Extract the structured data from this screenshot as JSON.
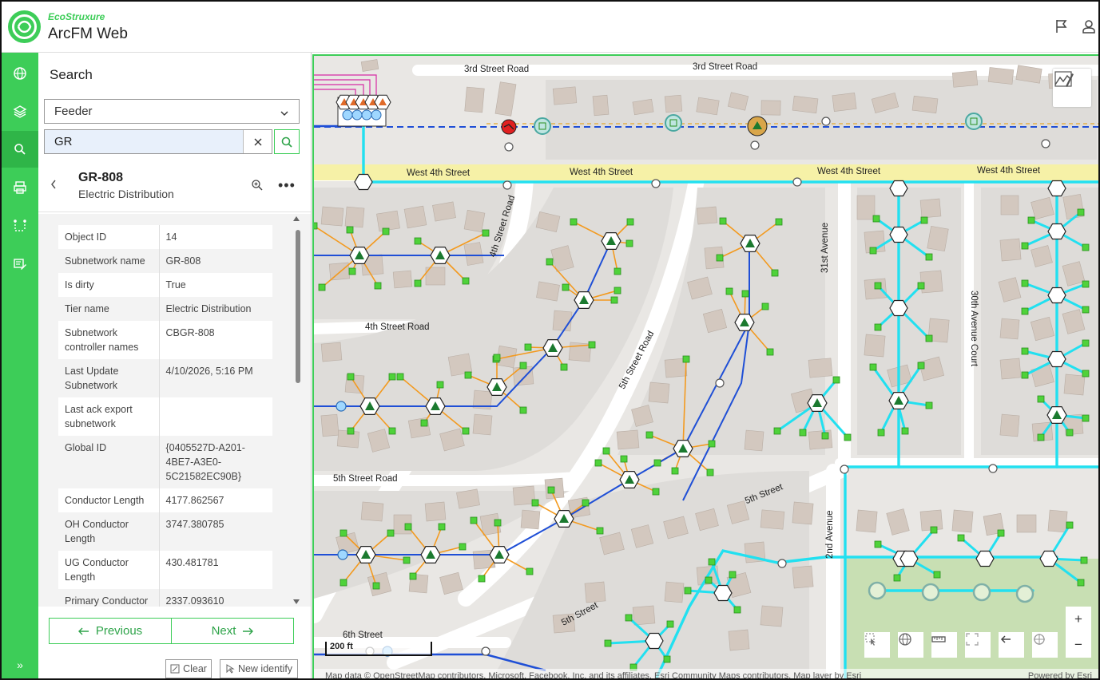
{
  "header": {
    "brand": "EcoStruxure",
    "app_title": "ArcFM Web"
  },
  "rail": {
    "items": [
      {
        "icon": "globe-icon"
      },
      {
        "icon": "layers-icon"
      },
      {
        "icon": "search-icon"
      },
      {
        "icon": "print-icon"
      },
      {
        "icon": "trace-icon"
      },
      {
        "icon": "edit-icon"
      }
    ],
    "collapse_label": "»"
  },
  "panel": {
    "title": "Search",
    "layer_select": "Feeder",
    "search_value": "GR",
    "feature": {
      "title": "GR-808",
      "subtitle": "Electric Distribution"
    },
    "attributes": [
      {
        "key": "Object ID",
        "value": "14"
      },
      {
        "key": "Subnetwork name",
        "value": "GR-808"
      },
      {
        "key": "Is dirty",
        "value": "True"
      },
      {
        "key": "Tier name",
        "value": "Electric Distribution"
      },
      {
        "key": "Subnetwork controller names",
        "value": "CBGR-808"
      },
      {
        "key": "Last Update Subnetwork",
        "value": "4/10/2026, 5:16 PM"
      },
      {
        "key": "Last ack export subnetwork",
        "value": ""
      },
      {
        "key": "Global ID",
        "value": "{0405527D-A201-4BE7-A3E0-5C21582EC90B}"
      },
      {
        "key": "Conductor Length",
        "value": "4177.862567"
      },
      {
        "key": "OH Conductor Length",
        "value": "3747.380785"
      },
      {
        "key": "UG Conductor Length",
        "value": "430.481781"
      },
      {
        "key": "Primary Conductor",
        "value": "2337.093610"
      }
    ],
    "previous_label": "Previous",
    "next_label": "Next",
    "clear_label": "Clear",
    "new_identify_label": "New identify"
  },
  "map": {
    "streets": {
      "third_street_road_a": "3rd Street Road",
      "third_street_road_b": "3rd Street Road",
      "west_4th_a": "West 4th Street",
      "west_4th_b": "West 4th Street",
      "west_4th_c": "West 4th Street",
      "west_4th_d": "West 4th Street",
      "fourth_street_road_a": "4th Street Road",
      "fourth_street_road_b": "4th Street Road",
      "fifth_street_road_a": "5th Street Road",
      "fifth_street_road_b": "5th Street Road",
      "thirty_first_avenue": "31st Avenue",
      "thirtieth_avenue_court": "30th Avenue Court",
      "fifth_street_a": "5th Street",
      "fifth_street_b": "5th Street",
      "sixth_street": "6th Street",
      "avenue_partial": "2nd Avenue"
    },
    "scale_label": "200 ft",
    "attribution": "Map data © OpenStreetMap contributors, Microsoft, Facebook, Inc. and its affiliates, Esri Community Maps contributors, Map layer by Esri",
    "powered_by": "Powered by Esri",
    "zoom_in": "+",
    "zoom_out": "−"
  },
  "colors": {
    "accent": "#3dcd58",
    "primary_line": "#1f4fd6",
    "secondary_line": "#f39a1f",
    "underground_line": "#22e0f0",
    "service_point": "#4fd23a"
  }
}
